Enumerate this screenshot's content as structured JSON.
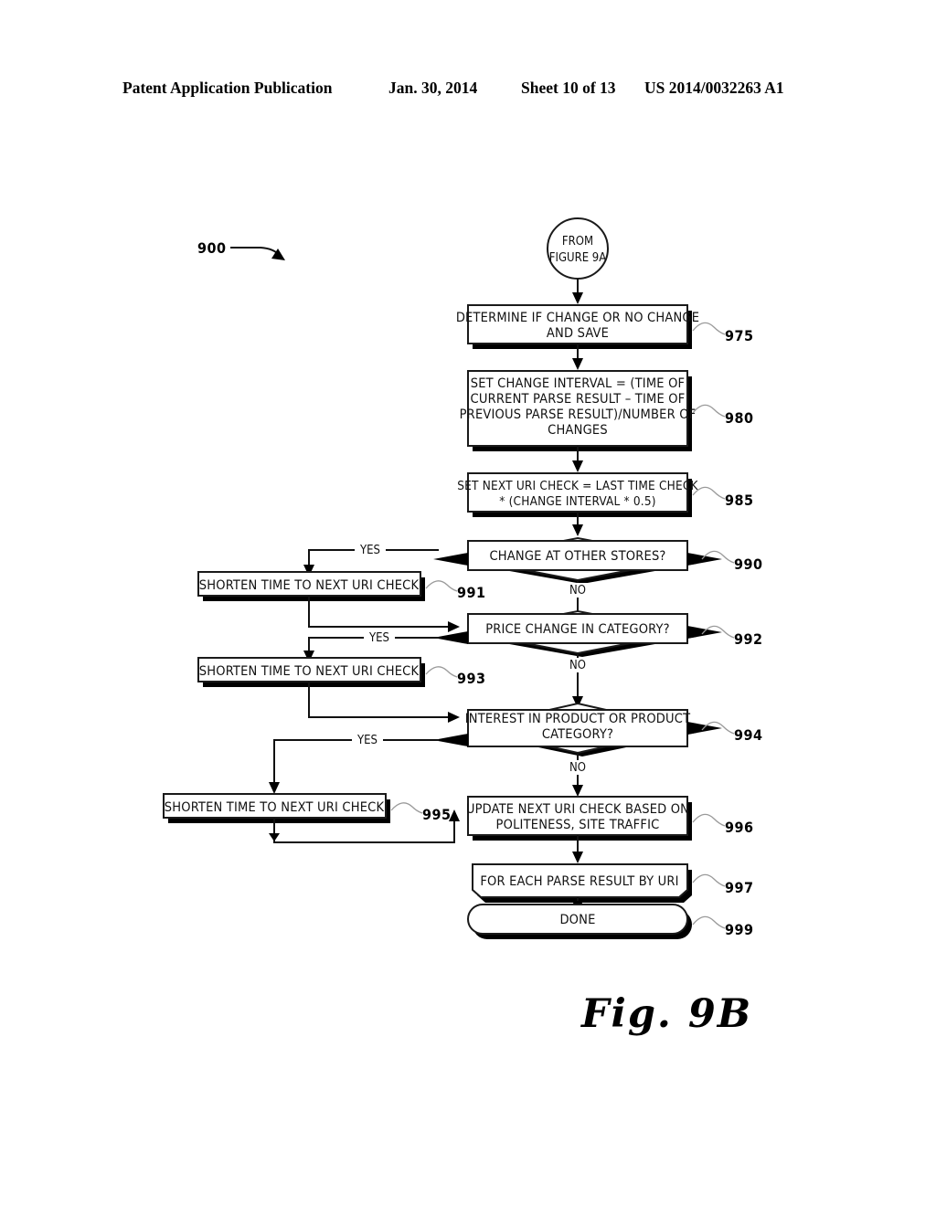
{
  "header": {
    "publication": "Patent Application Publication",
    "date": "Jan. 30, 2014",
    "sheet": "Sheet 10 of 13",
    "number": "US 2014/0032263 A1"
  },
  "figure": {
    "caption": "Fig. 9B",
    "diagram_ref": "900",
    "connector_in": "FROM FIGURE 9A",
    "connector_in_line1": "FROM",
    "connector_in_line2": "FIGURE 9A"
  },
  "nodes": [
    {
      "id": "975",
      "ref": "975",
      "type": "process",
      "lines": [
        "DETERMINE IF CHANGE OR NO CHANGE",
        "AND SAVE"
      ]
    },
    {
      "id": "980",
      "ref": "980",
      "type": "process",
      "lines": [
        "SET CHANGE INTERVAL = (TIME OF",
        "CURRENT PARSE RESULT – TIME OF",
        "PREVIOUS PARSE RESULT)/NUMBER OF",
        "CHANGES"
      ]
    },
    {
      "id": "985",
      "ref": "985",
      "type": "process",
      "lines": [
        "SET NEXT URI CHECK = LAST TIME CHECK",
        "* (CHANGE INTERVAL * 0.5)"
      ]
    },
    {
      "id": "990",
      "ref": "990",
      "type": "decision",
      "lines": [
        "CHANGE AT OTHER STORES?"
      ]
    },
    {
      "id": "991",
      "ref": "991",
      "type": "process",
      "lines": [
        "SHORTEN TIME TO NEXT URI CHECK"
      ]
    },
    {
      "id": "992",
      "ref": "992",
      "type": "decision",
      "lines": [
        "PRICE CHANGE IN CATEGORY?"
      ]
    },
    {
      "id": "993",
      "ref": "993",
      "type": "process",
      "lines": [
        "SHORTEN TIME TO NEXT URI CHECK"
      ]
    },
    {
      "id": "994",
      "ref": "994",
      "type": "decision",
      "lines": [
        "INTEREST IN PRODUCT OR PRODUCT",
        "CATEGORY?"
      ]
    },
    {
      "id": "995",
      "ref": "995",
      "type": "process",
      "lines": [
        "SHORTEN TIME TO NEXT URI CHECK"
      ]
    },
    {
      "id": "996",
      "ref": "996",
      "type": "process",
      "lines": [
        "UPDATE NEXT URI CHECK BASED ON",
        "POLITENESS, SITE TRAFFIC"
      ]
    },
    {
      "id": "997",
      "ref": "997",
      "type": "loop",
      "lines": [
        "FOR EACH PARSE RESULT BY URI"
      ]
    },
    {
      "id": "999",
      "ref": "999",
      "type": "terminator",
      "lines": [
        "DONE"
      ]
    }
  ],
  "edge_labels": {
    "yes_990": "YES",
    "no_990": "NO",
    "yes_992": "YES",
    "no_992": "NO",
    "yes_994": "YES",
    "no_994": "NO"
  },
  "colors": {
    "ink": "#111111",
    "leader": "#9a9a9a",
    "paper": "#ffffff"
  }
}
